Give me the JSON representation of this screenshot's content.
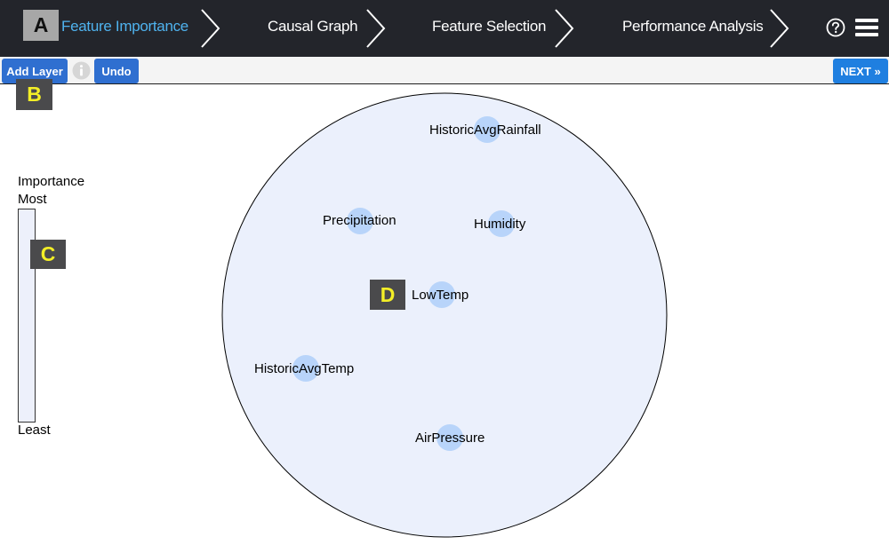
{
  "nav": {
    "steps": [
      {
        "label": "Feature Importance"
      },
      {
        "label": "Causal Graph"
      },
      {
        "label": "Feature Selection"
      },
      {
        "label": "Performance Analysis"
      }
    ]
  },
  "toolbar": {
    "add_layer_label": "Add Layer",
    "undo_label": "Undo",
    "next_label": "NEXT »"
  },
  "markers": {
    "a": "A",
    "b": "B",
    "c": "C",
    "d": "D"
  },
  "legend": {
    "title": "Importance",
    "most": "Most",
    "least": "Least"
  },
  "features": [
    {
      "label": "HistoricAvgRainfall"
    },
    {
      "label": "Precipitation"
    },
    {
      "label": "Humidity"
    },
    {
      "label": "LowTemp"
    },
    {
      "label": "HistoricAvgTemp"
    },
    {
      "label": "AirPressure"
    }
  ],
  "colors": {
    "nav_bg": "#23252b",
    "active_step": "#4fb3ef",
    "button_blue": "#2f6fd0",
    "next_blue": "#1f7fe0",
    "circle_fill": "#ebf0fc",
    "node_fill": "#b8d4fa"
  }
}
